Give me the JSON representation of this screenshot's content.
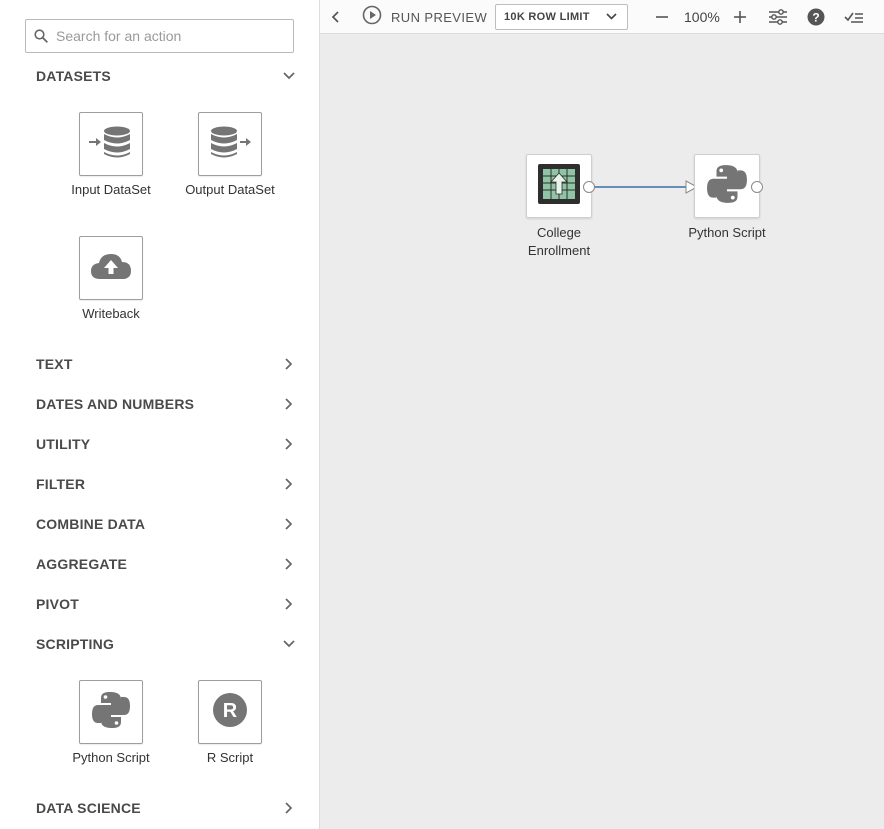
{
  "search": {
    "placeholder": "Search for an action"
  },
  "sections": {
    "datasets": "DATASETS",
    "text": "TEXT",
    "dates_numbers": "DATES AND NUMBERS",
    "utility": "UTILITY",
    "filter": "FILTER",
    "combine": "COMBINE DATA",
    "aggregate": "AGGREGATE",
    "pivot": "PIVOT",
    "scripting": "SCRIPTING",
    "data_science": "DATA SCIENCE"
  },
  "tiles": {
    "input_dataset": "Input DataSet",
    "output_dataset": "Output DataSet",
    "writeback": "Writeback",
    "python_script": "Python Script",
    "r_script": "R Script"
  },
  "toolbar": {
    "run_preview": "RUN PREVIEW",
    "row_limit": "10K ROW LIMIT",
    "zoom": "100%"
  },
  "canvas": {
    "nodes": {
      "source": {
        "label_line1": "College",
        "label_line2": "Enrollment"
      },
      "python": {
        "label": "Python Script"
      }
    }
  },
  "colors": {
    "connector": "#3b6ea5",
    "icon_gray": "#757575",
    "sheet_green": "#8fc5a4"
  },
  "icons": [
    "search-icon",
    "chevron-down-icon",
    "chevron-right-icon",
    "input-dataset-icon",
    "output-dataset-icon",
    "cloud-upload-icon",
    "python-icon",
    "r-script-icon",
    "play-icon",
    "back-chevron-icon",
    "zoom-out-icon",
    "zoom-in-icon",
    "settings-sliders-icon",
    "help-icon",
    "checklist-icon"
  ]
}
